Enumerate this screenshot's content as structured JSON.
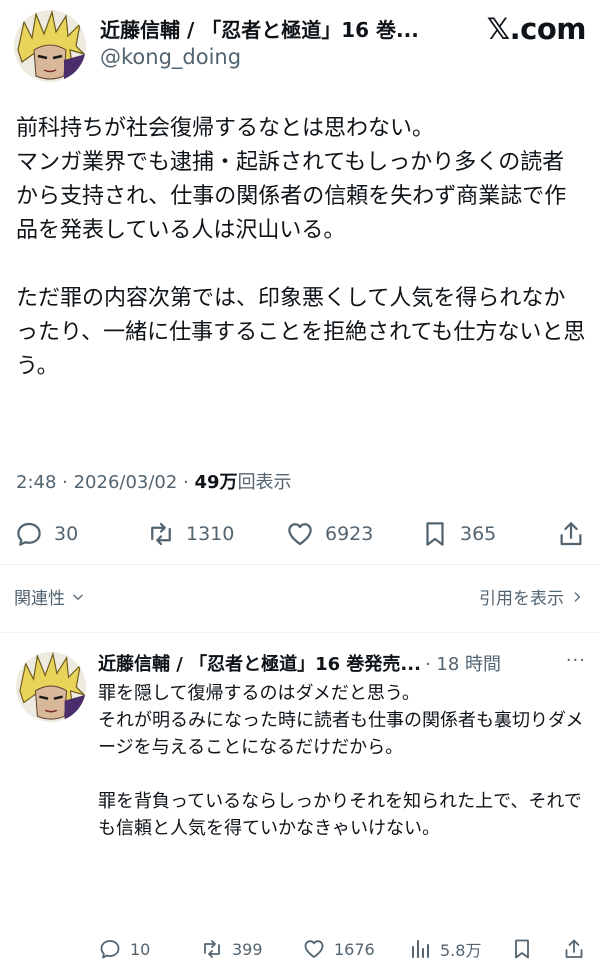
{
  "tweet": {
    "author_name": "近藤信輔 / 「忍者と極道」16 巻...",
    "handle": "@kong_doing",
    "brand": "𝕏.com",
    "body": "前科持ちが社会復帰するなとは思わない。\nマンガ業界でも逮捕・起訴されてもしっかり多くの読者から支持され、仕事の関係者の信頼を失わず商業誌で作品を発表している人は沢山いる。\n\nただ罪の内容次第では、印象悪くして人気を得られなかったり、一緒に仕事することを拒絶されても仕方ないと思う。",
    "time": "2:48 · 2026/03/02 · ",
    "views_count": "49万",
    "views_label": "回表示",
    "stats": {
      "replies": "30",
      "retweets": "1310",
      "likes": "6923",
      "bookmarks": "365"
    }
  },
  "relevance": {
    "sort_label": "関連性",
    "quotes_label": "引用を表示"
  },
  "reply": {
    "author_name": "近藤信輔 / 「忍者と極道」16 巻発売...",
    "time": "· 18 時間",
    "more": "···",
    "body": "罪を隠して復帰するのはダメだと思う。\nそれが明るみになった時に読者も仕事の関係者も裏切りダメージを与えることになるだけだから。\n\n罪を背負っているならしっかりそれを知られた上で、それでも信頼と人気を得ていかなきゃいけない。",
    "stats": {
      "replies": "10",
      "retweets": "399",
      "likes": "1676",
      "views": "5.8万"
    }
  },
  "colors": {
    "text": "#0f1419",
    "secondary": "#536471",
    "divider": "#eff3f4"
  }
}
